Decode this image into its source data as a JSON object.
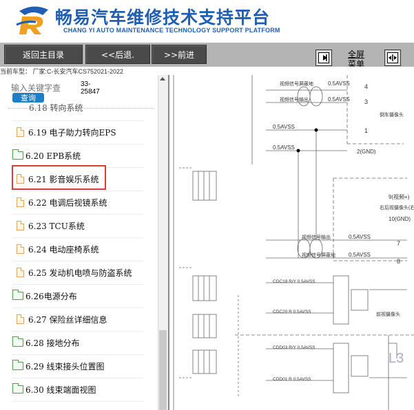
{
  "header": {
    "title_cn": "畅易汽车维修技术支持平台",
    "title_en": "CHANG YI AUTO MAINTENANCE TECHNOLOGY SUPPORT PLATFORM"
  },
  "toolbar": {
    "home_label": "返回主目录",
    "back_label": "<<后退.",
    "forward_label": ">>前进",
    "fullscreen_line1": "全屏",
    "fullscreen_line2": "菜单"
  },
  "vehicle": {
    "text": "当前车型： 厂家:C-长安汽车CS752021-2022"
  },
  "search": {
    "placeholder": "输入关键字查",
    "button_label": "查询",
    "code_line1": "33-",
    "code_line2": "25847"
  },
  "tree": {
    "partial_label": "6.18 转向系统",
    "items": [
      {
        "label": "6.19 电子助力转向EPS",
        "type": "doc"
      },
      {
        "label": "6.20 EPB系统",
        "type": "folder"
      },
      {
        "label": "6.21 影音娱乐系统",
        "type": "doc",
        "selected": true
      },
      {
        "label": "6.22 电调后视镜系统",
        "type": "doc"
      },
      {
        "label": "6.23 TCU系统",
        "type": "doc"
      },
      {
        "label": "6.24 电动座椅系统",
        "type": "doc"
      },
      {
        "label": "6.25 发动机电喷与防盗系统",
        "type": "doc"
      },
      {
        "label": "6.26电源分布",
        "type": "folder"
      },
      {
        "label": "6.27 保险丝详细信息",
        "type": "doc"
      },
      {
        "label": "6.28 接地分布",
        "type": "folder"
      },
      {
        "label": "6.29 线束接头位置图",
        "type": "folder"
      },
      {
        "label": "6.30 线束端面视图",
        "type": "folder"
      }
    ]
  },
  "diagram": {
    "wire_labels": [
      "0.5AVSS",
      "0.5AVSS",
      "0.5AVSS",
      "0.5AVSS",
      "0.5AVSS",
      "0.5AVSS",
      "0.5AVSS"
    ],
    "signal_labels": [
      "视频信号屏蔽地",
      "视频信号输出",
      "视频信号输出",
      "视频信号屏蔽地"
    ],
    "pin_numbers": [
      "4",
      "3",
      "1",
      "2(GND)",
      "9(视频+)",
      "10(GND)",
      "7",
      "8"
    ],
    "camera_labels": [
      "倒车摄像头",
      "右后视摄像头(右外后视镜)",
      "前视摄像头"
    ],
    "bus_labels": [
      "CDC19 R/Y 0.5AVSS",
      "CDC20 R 0.5AVSS",
      "CDD03 R/Y 0.5AVSS",
      "CDD01 R 0.5AVSS"
    ],
    "corner_label": "L3"
  },
  "colors": {
    "brand_blue": "#1e5fb4",
    "toolbar_bg": "#b4b4b4",
    "button_bg": "#4a4a4a",
    "search_btn": "#1e7fc6",
    "highlight": "#d93a3a"
  }
}
